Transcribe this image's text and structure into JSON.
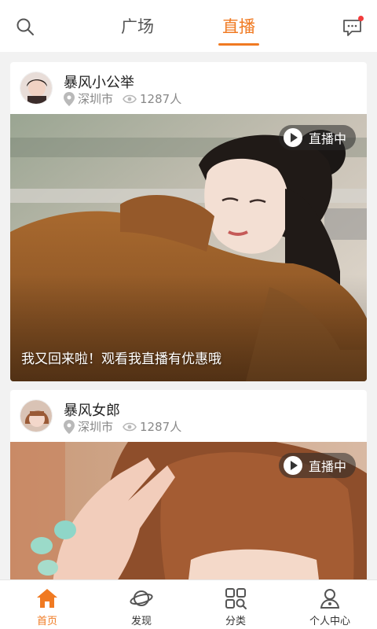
{
  "colors": {
    "accent": "#f07a22",
    "badge_dot": "#f23b3b"
  },
  "header": {
    "search_icon": "search-icon",
    "tabs": [
      {
        "label": "广场"
      },
      {
        "label": "直播"
      }
    ],
    "active_tab": "直播",
    "message_icon": "message-icon"
  },
  "feed": [
    {
      "user": "暴风小公举",
      "location": "深圳市",
      "views": "1287人",
      "badge": "直播中",
      "caption": "我又回来啦！观看我直播有优惠哦"
    },
    {
      "user": "暴风女郎",
      "location": "深圳市",
      "views": "1287人",
      "badge": "直播中"
    }
  ],
  "bottom_nav": [
    {
      "label": "首页",
      "icon": "home-icon"
    },
    {
      "label": "发现",
      "icon": "planet-icon"
    },
    {
      "label": "分类",
      "icon": "grid-icon"
    },
    {
      "label": "个人中心",
      "icon": "user-icon"
    }
  ],
  "active_nav": "首页"
}
